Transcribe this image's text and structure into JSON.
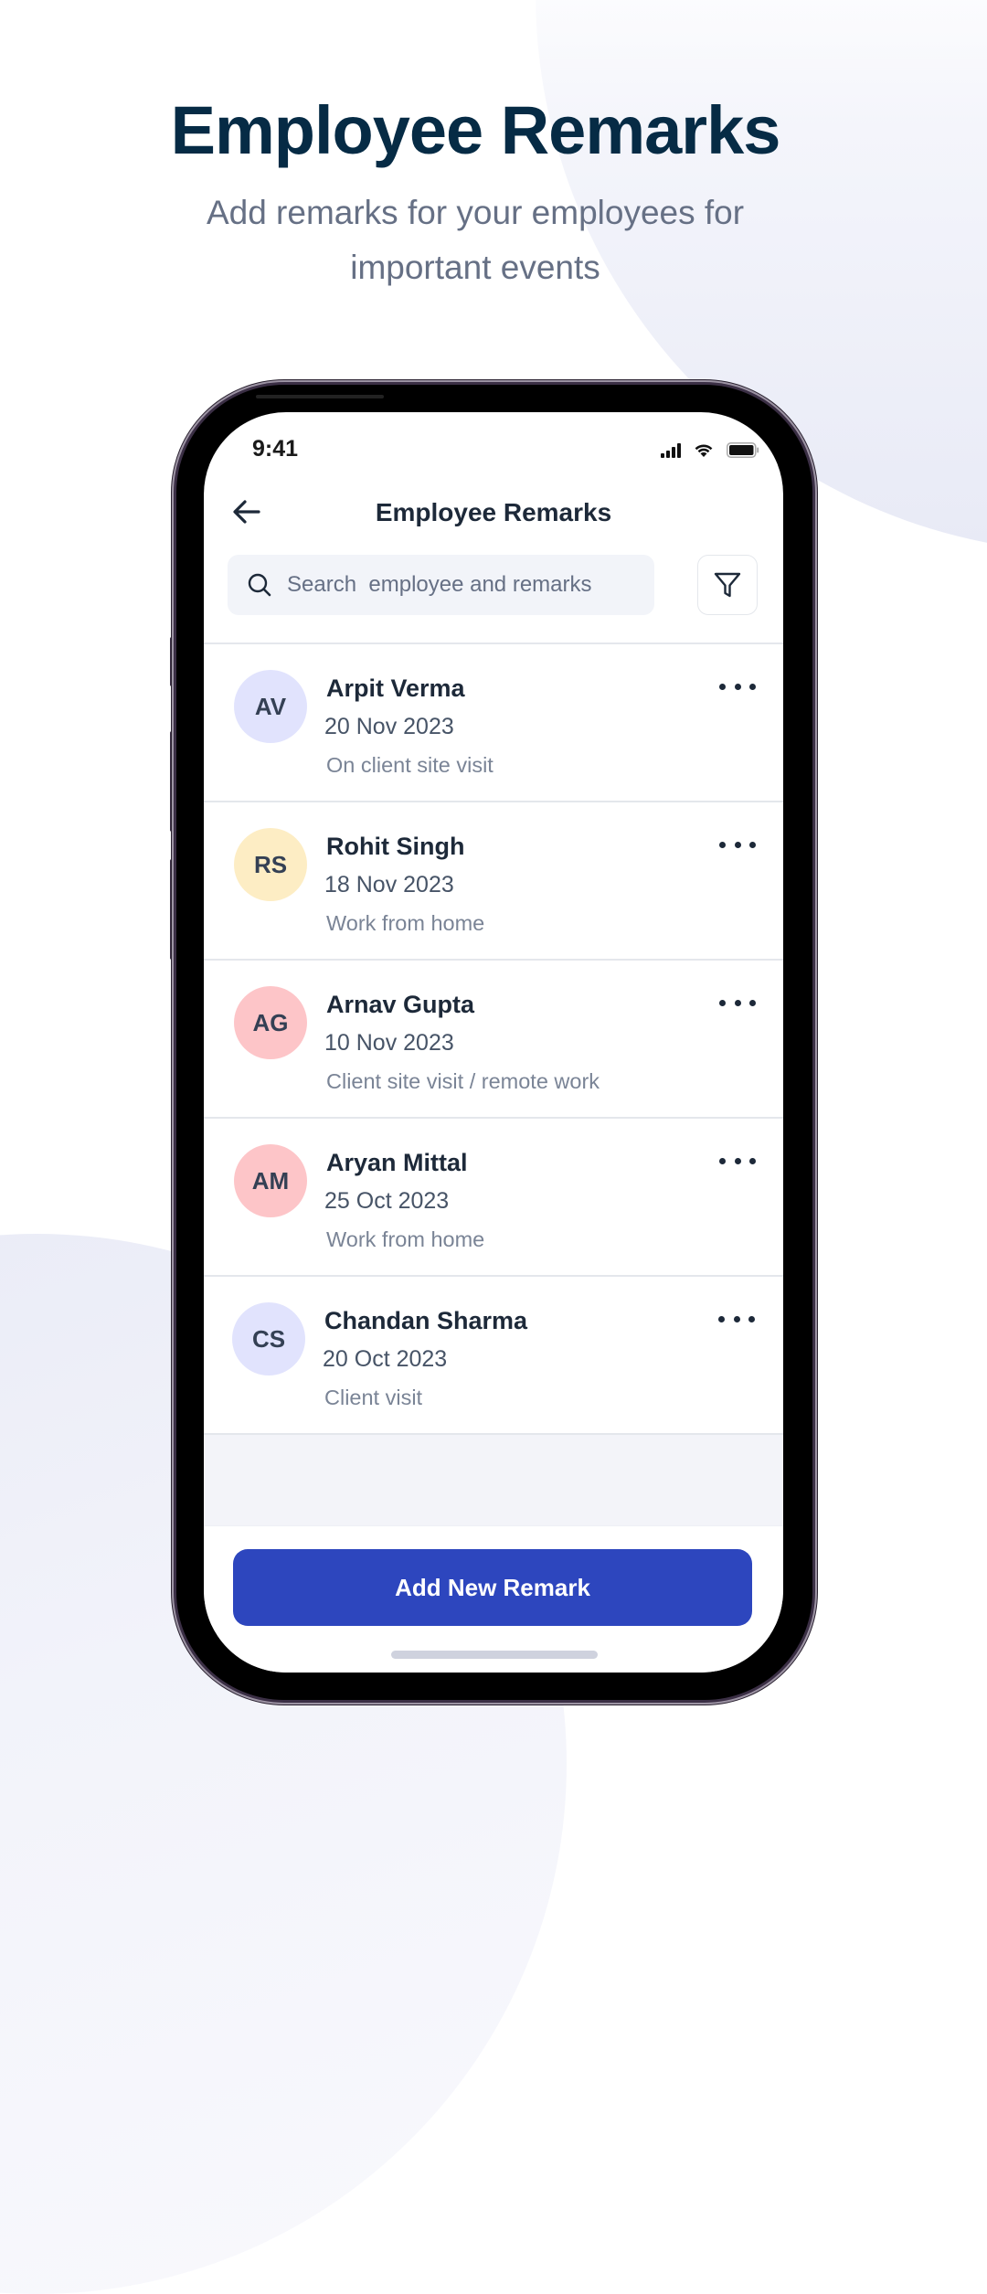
{
  "hero": {
    "title": "Employee Remarks",
    "subtitle": "Add remarks for your employees for important events"
  },
  "statusbar": {
    "time": "9:41",
    "icons": [
      "cellular-signal-icon",
      "wifi-icon",
      "battery-icon"
    ]
  },
  "header": {
    "title": "Employee Remarks",
    "back_icon": "arrow-left-icon"
  },
  "search": {
    "placeholder": "Search  employee and remarks",
    "value": "",
    "icon": "search-icon"
  },
  "filter": {
    "icon": "filter-funnel-icon"
  },
  "colors": {
    "title": "#062B45",
    "accent": "#2D46BE",
    "text_primary": "#1D2939",
    "text_secondary": "#475467",
    "text_muted": "#7A8496"
  },
  "employees": [
    {
      "initials": "AV",
      "name": "Arpit Verma",
      "date": "20 Nov 2023",
      "remark": "On client site visit",
      "avatar_color": "#E1E3FD"
    },
    {
      "initials": "RS",
      "name": "Rohit Singh",
      "date": "18 Nov 2023",
      "remark": "Work from home",
      "avatar_color": "#FDEDC4"
    },
    {
      "initials": "AG",
      "name": "Arnav Gupta",
      "date": "10 Nov 2023",
      "remark": "Client site visit / remote work",
      "avatar_color": "#FDC5C8"
    },
    {
      "initials": "AM",
      "name": "Aryan Mittal",
      "date": "25 Oct 2023",
      "remark": "Work from home",
      "avatar_color": "#FDC5C8"
    },
    {
      "initials": "CS",
      "name": "Chandan Sharma",
      "date": "20 Oct 2023",
      "remark": "Client visit",
      "avatar_color": "#E1E3FD"
    }
  ],
  "footer": {
    "add_button_label": "Add New Remark"
  }
}
